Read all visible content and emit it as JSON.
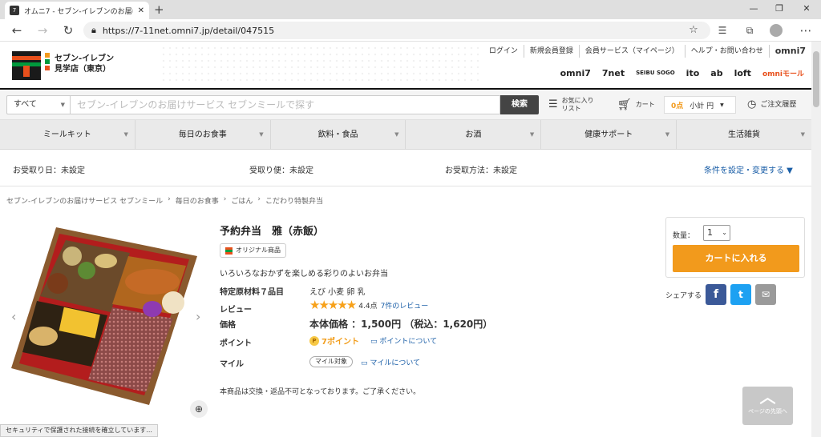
{
  "browser": {
    "tab_title": "オムニ7 - セブン-イレブンのお届けサ...",
    "url": "https://7-11net.omni7.jp/detail/047515"
  },
  "header": {
    "store_name": "セブン-イレブン",
    "store_branch": "見学店（東京）",
    "links": [
      "ログイン",
      "新規会員登録",
      "会員サービス（マイページ）",
      "ヘルプ・お問い合わせ",
      "omni7"
    ],
    "brands": [
      "omni7",
      "7net",
      "SEIBU SOGO",
      "ito",
      "ab",
      "loft",
      "omniモール"
    ]
  },
  "search": {
    "category": "すべて",
    "placeholder": "セブン-イレブンのお届けサービス セブンミールで探す",
    "button": "検索",
    "favorites": "お気に入り\nリスト",
    "cart": "カート",
    "points": "0点",
    "subtotal": "小計 円",
    "history": "ご注文履歴"
  },
  "menu": [
    "ミールキット",
    "毎日のお食事",
    "飲料・食品",
    "お酒",
    "健康サポート",
    "生活雑貨"
  ],
  "delivery": {
    "date": "お受取り日：未設定",
    "slot": "受取り便：未設定",
    "method": "お受取方法：未設定",
    "condition": "条件を設定・変更する ▼"
  },
  "breadcrumb": [
    "セブン-イレブンのお届けサービス セブンミール",
    "›",
    "毎日のお食事",
    "›",
    "ごはん",
    "›",
    "こだわり特製弁当"
  ],
  "product": {
    "name": "予約弁当　雅（赤飯）",
    "badge": "オリジナル商品",
    "description": "いろいろなおかずを楽しめる彩りのよいお弁当",
    "allergen_label": "特定原材料７品目",
    "allergen_value": "えび 小麦 卵 乳",
    "review_label": "レビュー",
    "rating": 4.4,
    "rating_text": "4.4点",
    "reviews_link": "7件のレビュー",
    "price_label": "価格",
    "price_text": "本体価格 ：1,500円 （税込：1,620円）",
    "point_label": "ポイント",
    "point_value": "7ポイント",
    "point_link": "ポイントについて",
    "mile_label": "マイル",
    "mile_tag": "マイル対象",
    "mile_link": "マイルについて",
    "notice": "本商品は交換・返品不可となっております。ご了承ください。"
  },
  "buy": {
    "qty_label": "数量：",
    "qty": "1",
    "cart_button": "カートに入れる",
    "share_label": "シェアする"
  },
  "to_top": "ページの先頭へ",
  "status": "セキュリティで保護された接続を確立しています...",
  "colors": {
    "orange": "#f29a1c",
    "link": "#1a5ea7",
    "seven_red": "#e8501c",
    "seven_green": "#009a3d"
  }
}
